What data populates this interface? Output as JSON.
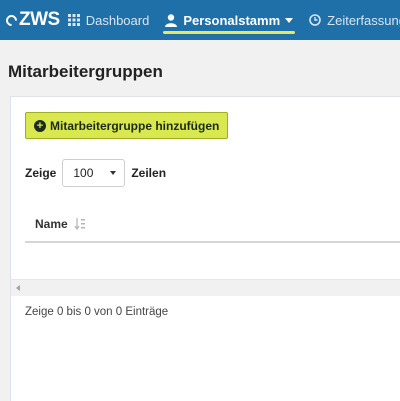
{
  "navbar": {
    "logo": "ZWS",
    "items": [
      {
        "label": "Dashboard",
        "icon": "grid-icon",
        "active": false
      },
      {
        "label": "Personalstamm",
        "icon": "user-icon",
        "active": true,
        "dropdown": true
      },
      {
        "label": "Zeiterfassung",
        "icon": "clock-icon",
        "active": false
      }
    ],
    "background": "#1f6fa8",
    "active_underline": "#e8e85a"
  },
  "page": {
    "title": "Mitarbeitergruppen"
  },
  "toolbar": {
    "add_label": "Mitarbeitergruppe hinzufügen",
    "add_icon": "plus-circle-icon",
    "add_color": "#d9e84f"
  },
  "table": {
    "length_prefix": "Zeige",
    "length_value": "100",
    "length_suffix": "Zeilen",
    "columns": [
      {
        "label": "Name",
        "sort_icon": "sort-alpha-icon"
      }
    ],
    "rows": [],
    "info": "Zeige 0 bis 0 von 0 Einträge"
  }
}
